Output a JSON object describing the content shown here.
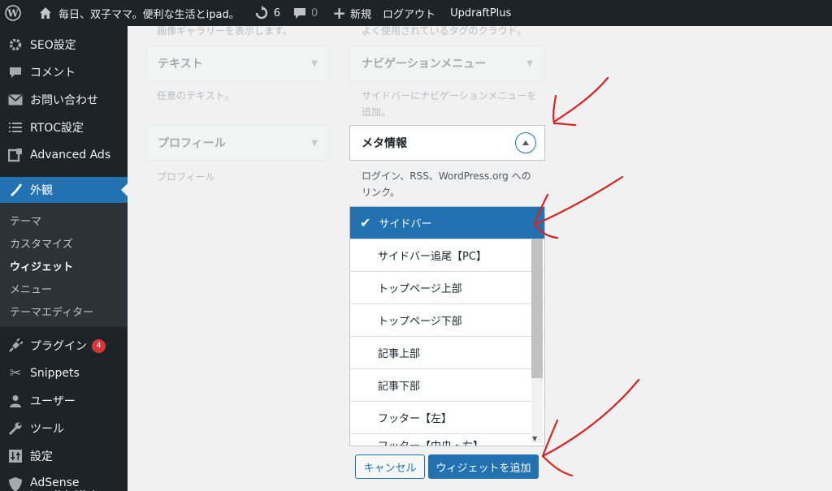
{
  "adminbar": {
    "site_name": "毎日、双子ママ。便利な生活とipad。",
    "updates_count": "6",
    "comments_count": "0",
    "new_label": "新規",
    "logout_label": "ログアウト",
    "plugin_label": "UpdraftPlus"
  },
  "sidebar": {
    "items": [
      {
        "label": "SEO設定",
        "icon": "gear-icon"
      },
      {
        "label": "コメント",
        "icon": "comment-icon"
      },
      {
        "label": "お問い合わせ",
        "icon": "mail-icon"
      },
      {
        "label": "RTOC設定",
        "icon": "list-icon"
      },
      {
        "label": "Advanced Ads",
        "icon": "ads-icon"
      }
    ],
    "current": {
      "label": "外観",
      "icon": "paintbrush-icon"
    },
    "submenu": [
      "テーマ",
      "カスタマイズ",
      "ウィジェット",
      "メニュー",
      "テーマエディター"
    ],
    "submenu_current": "ウィジェット",
    "items_after": [
      {
        "label": "プラグイン",
        "icon": "plugin-icon",
        "badge": "4"
      },
      {
        "label": "Snippets",
        "icon": "scissors-icon"
      },
      {
        "label": "ユーザー",
        "icon": "user-icon"
      },
      {
        "label": "ツール",
        "icon": "wrench-icon"
      },
      {
        "label": "設定",
        "icon": "settings-icon"
      },
      {
        "label": "AdSense Invalid Click Protector",
        "icon": "shield-icon"
      }
    ]
  },
  "widgets": {
    "top_desc_left": "画像ギャラリーを表示します。",
    "top_desc_right": "よく使用されているタグのクラウド。",
    "text_title": "テキスト",
    "text_desc": "任意のテキスト。",
    "nav_title": "ナビゲーションメニュー",
    "nav_desc": "サイドバーにナビゲーションメニューを追加。",
    "profile_title": "プロフィール",
    "profile_desc": "プロフィール",
    "meta_title": "メタ情報",
    "meta_desc": "ログイン、RSS、WordPress.org へのリンク。"
  },
  "choose_list": {
    "selected": "サイドバー",
    "items": [
      "サイドバー追尾【PC】",
      "トップページ上部",
      "トップページ下部",
      "記事上部",
      "記事下部",
      "フッター【左】",
      "フッター【中央・右】"
    ]
  },
  "buttons": {
    "cancel": "キャンセル",
    "add": "ウィジェットを追加"
  },
  "colors": {
    "accent": "#2271b1",
    "admin_dark": "#1d2327",
    "annotation": "#d42424"
  }
}
